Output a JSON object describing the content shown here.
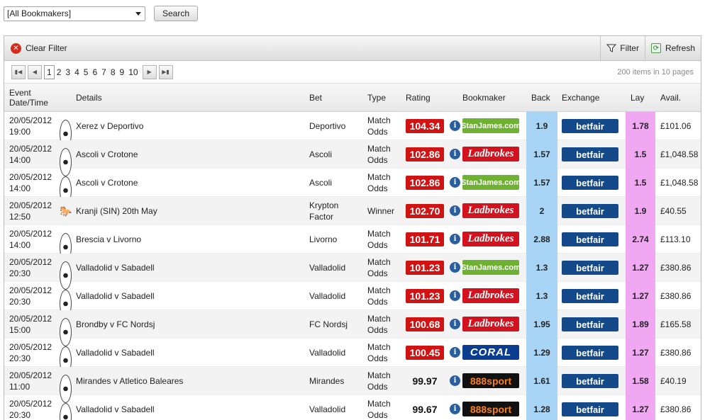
{
  "search": {
    "bookmaker_selected": "[All Bookmakers]",
    "button_label": "Search"
  },
  "toolbar": {
    "clear_filter_label": "Clear Filter",
    "filter_label": "Filter",
    "refresh_label": "Refresh"
  },
  "pager": {
    "pages": [
      "1",
      "2",
      "3",
      "4",
      "5",
      "6",
      "7",
      "8",
      "9",
      "10"
    ],
    "current": "1",
    "info": "200 items in 10 pages"
  },
  "columns": {
    "event_date": "Event Date/Time",
    "details": "Details",
    "bet": "Bet",
    "type": "Type",
    "rating": "Rating",
    "bookmaker": "Bookmaker",
    "back": "Back",
    "exchange": "Exchange",
    "lay": "Lay",
    "avail": "Avail."
  },
  "rows": [
    {
      "date": "20/05/2012",
      "time": "19:00",
      "sport_icon": "football-icon",
      "details": "Xerez v Deportivo",
      "bet": "Deportivo",
      "type": "Match Odds",
      "rating": "104.34",
      "rating_highlight": true,
      "bookmaker": "StanJames.com",
      "bookmaker_key": "stanjames",
      "back": "1.9",
      "exchange": "betfair",
      "lay": "1.78",
      "avail": "£101.06"
    },
    {
      "date": "20/05/2012",
      "time": "14:00",
      "sport_icon": "football-icon",
      "details": "Ascoli v Crotone",
      "bet": "Ascoli",
      "type": "Match Odds",
      "rating": "102.86",
      "rating_highlight": true,
      "bookmaker": "Ladbrokes",
      "bookmaker_key": "ladbrokes",
      "back": "1.57",
      "exchange": "betfair",
      "lay": "1.5",
      "avail": "£1,048.58"
    },
    {
      "date": "20/05/2012",
      "time": "14:00",
      "sport_icon": "football-icon",
      "details": "Ascoli v Crotone",
      "bet": "Ascoli",
      "type": "Match Odds",
      "rating": "102.86",
      "rating_highlight": true,
      "bookmaker": "StanJames.com",
      "bookmaker_key": "stanjames",
      "back": "1.57",
      "exchange": "betfair",
      "lay": "1.5",
      "avail": "£1,048.58"
    },
    {
      "date": "20/05/2012",
      "time": "12:50",
      "sport_icon": "horse-icon",
      "details": "Kranji (SIN) 20th May",
      "bet": "Krypton Factor",
      "type": "Winner",
      "rating": "102.70",
      "rating_highlight": true,
      "bookmaker": "Ladbrokes",
      "bookmaker_key": "ladbrokes",
      "back": "2",
      "exchange": "betfair",
      "lay": "1.9",
      "avail": "£40.55"
    },
    {
      "date": "20/05/2012",
      "time": "14:00",
      "sport_icon": "football-icon",
      "details": "Brescia v Livorno",
      "bet": "Livorno",
      "type": "Match Odds",
      "rating": "101.71",
      "rating_highlight": true,
      "bookmaker": "Ladbrokes",
      "bookmaker_key": "ladbrokes",
      "back": "2.88",
      "exchange": "betfair",
      "lay": "2.74",
      "avail": "£113.10"
    },
    {
      "date": "20/05/2012",
      "time": "20:30",
      "sport_icon": "football-icon",
      "details": "Valladolid v Sabadell",
      "bet": "Valladolid",
      "type": "Match Odds",
      "rating": "101.23",
      "rating_highlight": true,
      "bookmaker": "StanJames.com",
      "bookmaker_key": "stanjames",
      "back": "1.3",
      "exchange": "betfair",
      "lay": "1.27",
      "avail": "£380.86"
    },
    {
      "date": "20/05/2012",
      "time": "20:30",
      "sport_icon": "football-icon",
      "details": "Valladolid v Sabadell",
      "bet": "Valladolid",
      "type": "Match Odds",
      "rating": "101.23",
      "rating_highlight": true,
      "bookmaker": "Ladbrokes",
      "bookmaker_key": "ladbrokes",
      "back": "1.3",
      "exchange": "betfair",
      "lay": "1.27",
      "avail": "£380.86"
    },
    {
      "date": "20/05/2012",
      "time": "15:00",
      "sport_icon": "football-icon",
      "details": "Brondby v FC Nordsj",
      "bet": "FC Nordsj",
      "type": "Match Odds",
      "rating": "100.68",
      "rating_highlight": true,
      "bookmaker": "Ladbrokes",
      "bookmaker_key": "ladbrokes",
      "back": "1.95",
      "exchange": "betfair",
      "lay": "1.89",
      "avail": "£165.58"
    },
    {
      "date": "20/05/2012",
      "time": "20:30",
      "sport_icon": "football-icon",
      "details": "Valladolid v Sabadell",
      "bet": "Valladolid",
      "type": "Match Odds",
      "rating": "100.45",
      "rating_highlight": true,
      "bookmaker": "CORAL",
      "bookmaker_key": "coral",
      "back": "1.29",
      "exchange": "betfair",
      "lay": "1.27",
      "avail": "£380.86"
    },
    {
      "date": "20/05/2012",
      "time": "11:00",
      "sport_icon": "football-icon",
      "details": "Mirandes v Atletico Baleares",
      "bet": "Mirandes",
      "type": "Match Odds",
      "rating": "99.97",
      "rating_highlight": false,
      "bookmaker": "888sport",
      "bookmaker_key": "888sport",
      "back": "1.61",
      "exchange": "betfair",
      "lay": "1.58",
      "avail": "£40.19"
    },
    {
      "date": "20/05/2012",
      "time": "20:30",
      "sport_icon": "football-icon",
      "details": "Valladolid v Sabadell",
      "bet": "Valladolid",
      "type": "Match Odds",
      "rating": "99.67",
      "rating_highlight": false,
      "bookmaker": "888sport",
      "bookmaker_key": "888sport",
      "back": "1.28",
      "exchange": "betfair",
      "lay": "1.27",
      "avail": "£380.86"
    }
  ]
}
